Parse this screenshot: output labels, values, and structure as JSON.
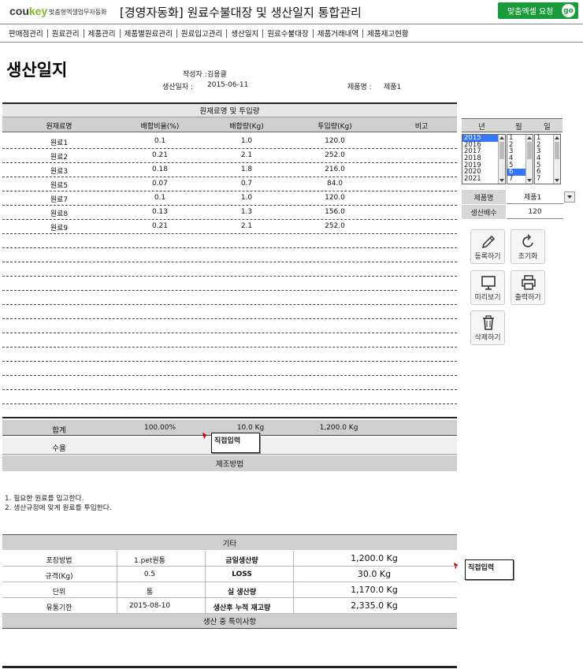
{
  "header": {
    "logo_main": "cou",
    "logo_key": "key",
    "logo_sub": "맞춤형엑셀업무자동화",
    "title": "[경영자동화] 원료수불대장 및 생산일지 통합관리",
    "request_btn": "맞춤엑셀 요청",
    "go_label": "go"
  },
  "nav": [
    "판매점관리",
    "원료관리",
    "제품관리",
    "제품별원료관리",
    "원료입고관리",
    "생산일지",
    "원료수불대장",
    "제품거래내역",
    "제품재고현황"
  ],
  "page": {
    "title": "생산일지",
    "writer_label": "작성자 :",
    "writer": "김용클",
    "date_label": "생산일자 :",
    "date": "2015-06-11",
    "product_label": "제품명 :",
    "product": "제품1"
  },
  "materials": {
    "section_title": "원재료명 및 투입량",
    "headers": [
      "원재료명",
      "배합비율(%)",
      "배합량(Kg)",
      "투입량(Kg)",
      "비고"
    ],
    "rows": [
      [
        "원료1",
        "0.1",
        "1.0",
        "120.0",
        ""
      ],
      [
        "원료2",
        "0.21",
        "2.1",
        "252.0",
        ""
      ],
      [
        "원료3",
        "0.18",
        "1.8",
        "216.0",
        ""
      ],
      [
        "원료5",
        "0.07",
        "0.7",
        "84.0",
        ""
      ],
      [
        "원료7",
        "0.1",
        "1.0",
        "120.0",
        ""
      ],
      [
        "원료8",
        "0.13",
        "1.3",
        "156.0",
        ""
      ],
      [
        "원료9",
        "0.21",
        "2.1",
        "252.0",
        ""
      ]
    ],
    "total_label": "합계",
    "total_ratio": "100.00%",
    "total_qty": "10.0  Kg",
    "total_input": "1,200.0  Kg",
    "yield_label": "수율",
    "method_title": "제조방법",
    "method_lines": [
      "1. 필요한 원료를 입고한다.",
      "2. 생산규정에 맞게 원료를 투입한다."
    ]
  },
  "direct_input": "직접입력",
  "etc": {
    "title": "기타",
    "rows": [
      {
        "l1": "포장방법",
        "v1": "1.pet원통",
        "l2": "금일생산량",
        "v2": "1,200.0  Kg"
      },
      {
        "l1": "규격(Kg)",
        "v1": "0.5",
        "l2": "LOSS",
        "v2": "30.0  Kg"
      },
      {
        "l1": "단위",
        "v1": "통",
        "l2": "실 생산량",
        "v2": "1,170.0  Kg"
      },
      {
        "l1": "유통기한",
        "v1": "2015-08-10",
        "l2": "생산후 누적 재고량",
        "v2": "2,335.0  Kg"
      }
    ],
    "notes_title": "생산 중 특이사항"
  },
  "side": {
    "year_h": "년",
    "month_h": "월",
    "day_h": "일",
    "years": [
      "2015",
      "2016",
      "2017",
      "2018",
      "2019",
      "2020",
      "2021"
    ],
    "months": [
      "1",
      "2",
      "3",
      "4",
      "5",
      "6",
      "7"
    ],
    "days": [
      "1",
      "2",
      "3",
      "4",
      "5",
      "6",
      "7"
    ],
    "selected_year": "2015",
    "selected_month": "6",
    "product_label": "제품명",
    "product_value": "제품1",
    "multiple_label": "생산배수",
    "multiple_value": "120",
    "btn_register": "등록하기",
    "btn_reset": "초기화",
    "btn_preview": "미리보기",
    "btn_print": "출력하기",
    "btn_delete": "삭제하기"
  }
}
